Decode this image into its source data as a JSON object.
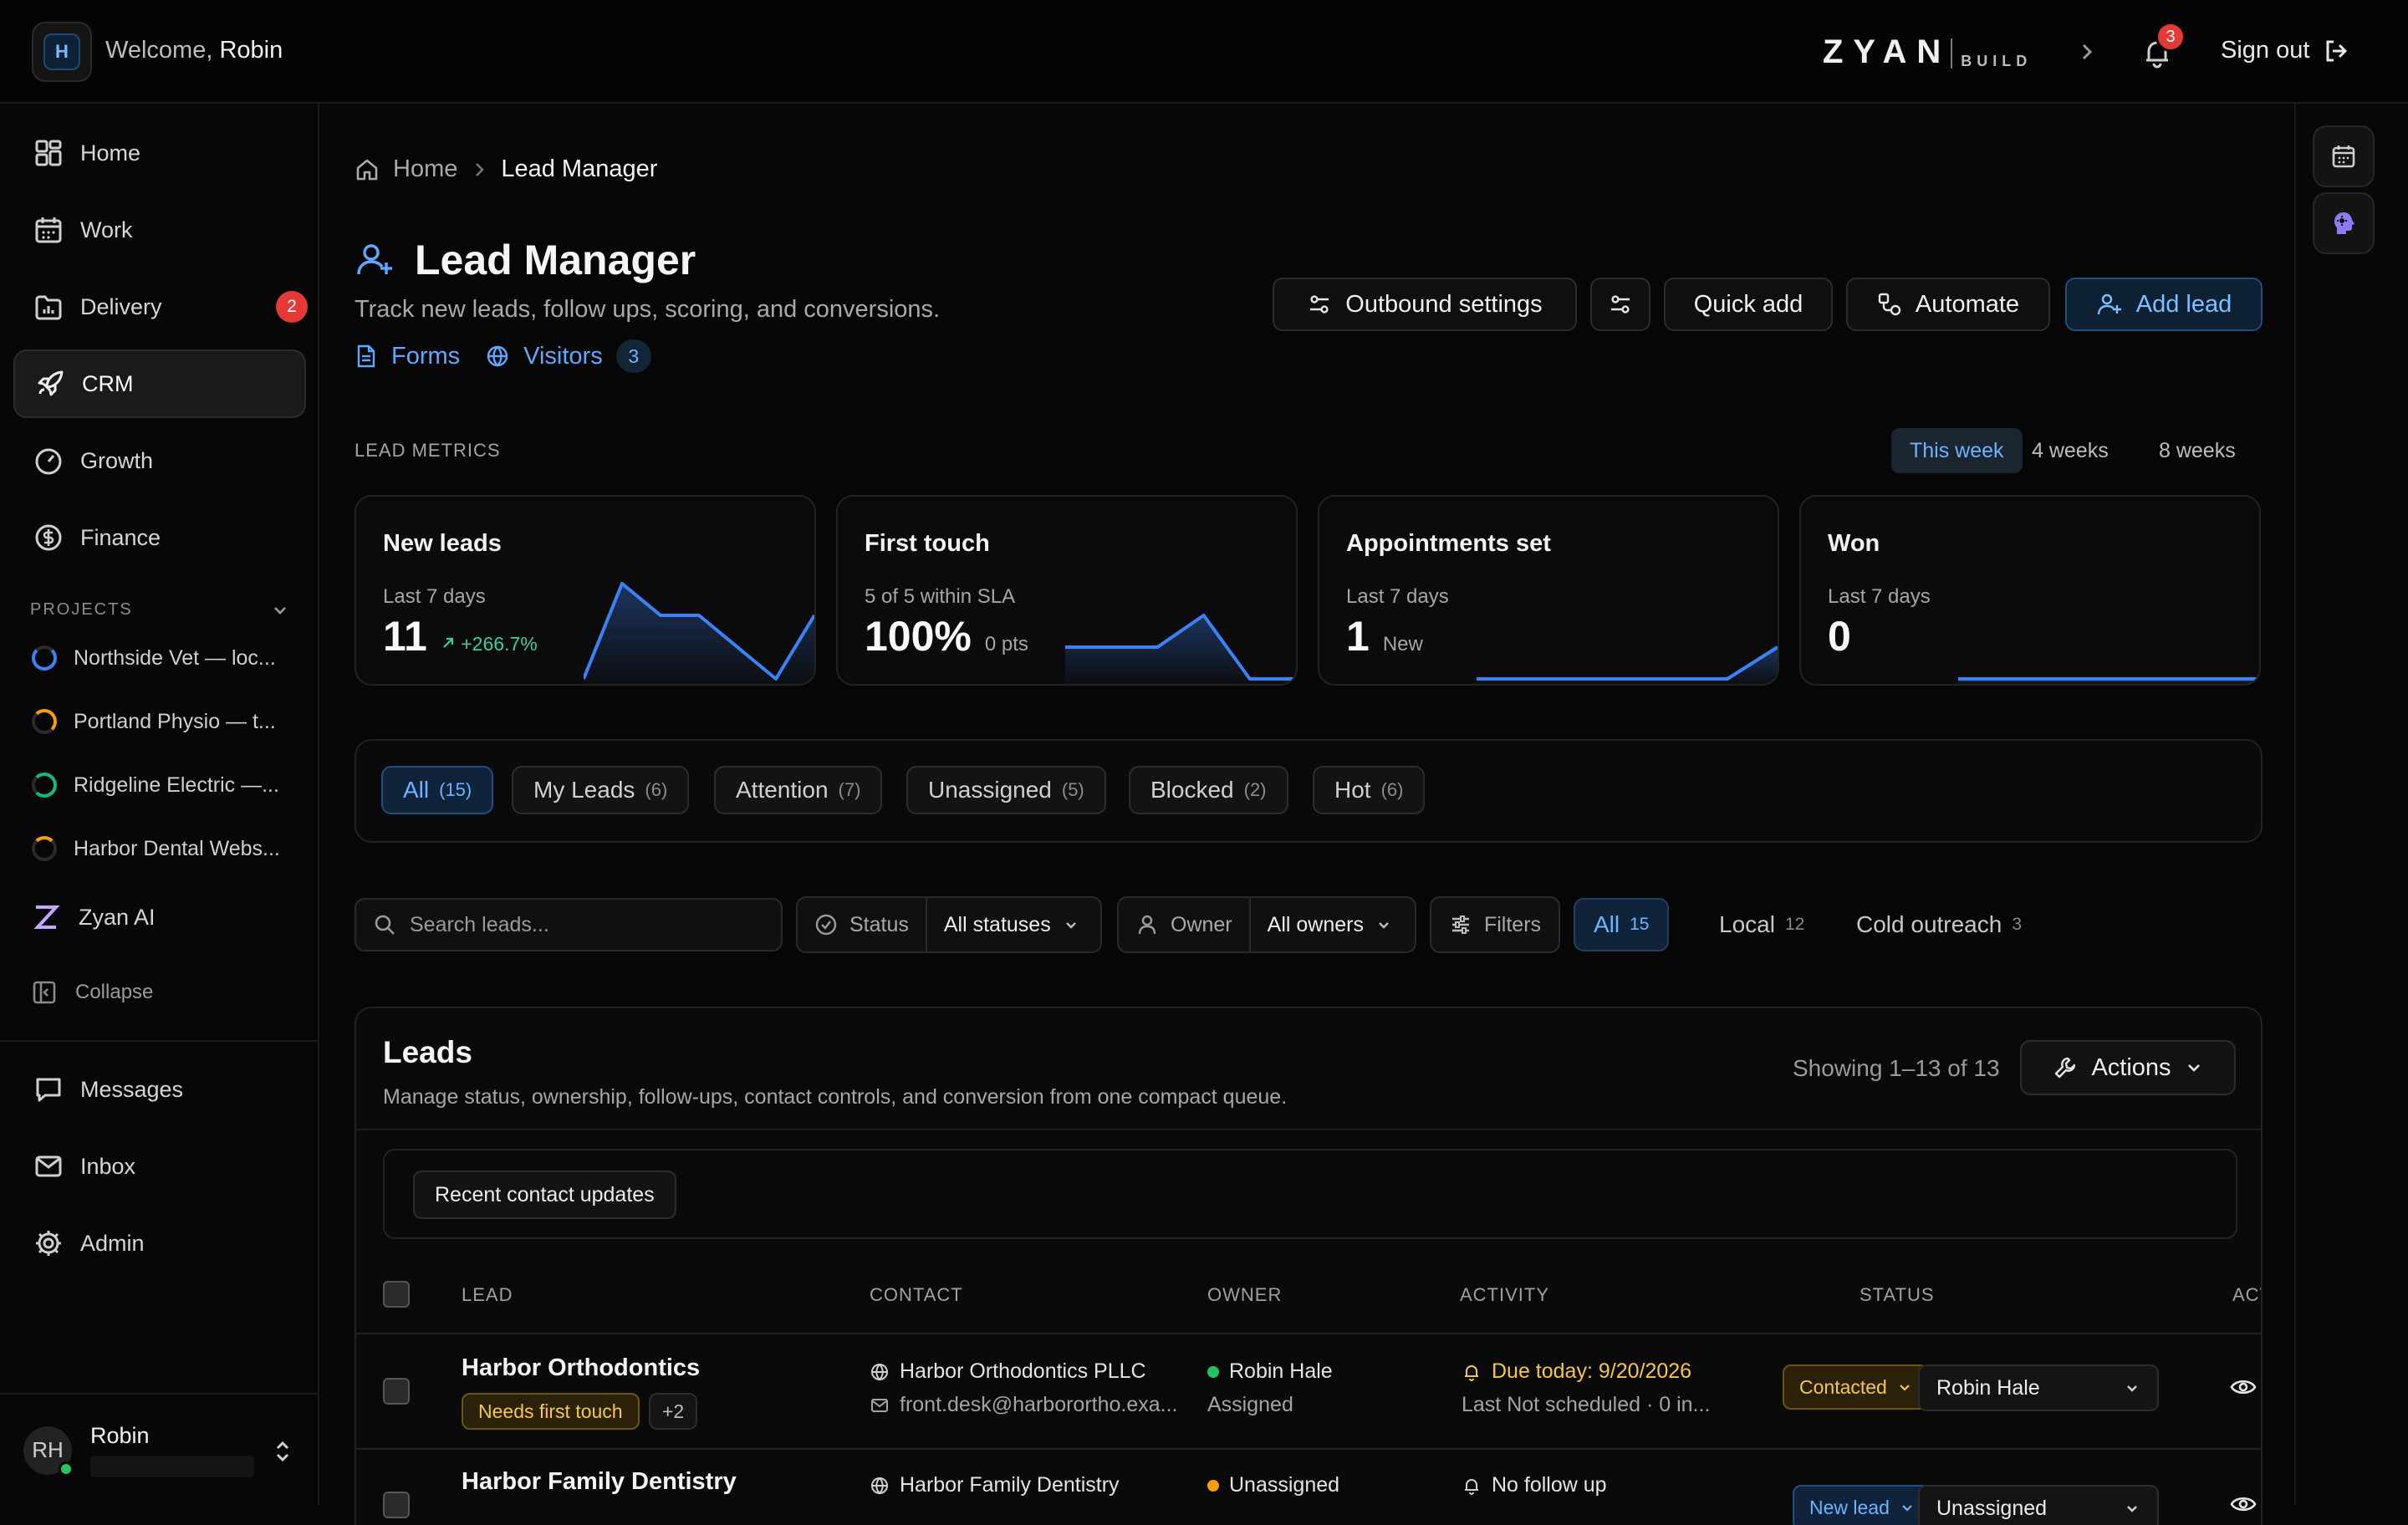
{
  "topbar": {
    "workspace_initial": "H",
    "welcome_prefix": "Welcome,",
    "welcome_name": "Robin",
    "brand": "ZYAN",
    "brand_sub": "BUILD",
    "notifications_count": "3",
    "sign_out": "Sign out"
  },
  "sidebar": {
    "items": [
      {
        "label": "Home",
        "icon": "dashboard-icon"
      },
      {
        "label": "Work",
        "icon": "calendar-icon"
      },
      {
        "label": "Delivery",
        "icon": "folder-chart-icon",
        "badge": "2"
      },
      {
        "label": "CRM",
        "icon": "rocket-icon",
        "active": true
      },
      {
        "label": "Growth",
        "icon": "gauge-icon"
      },
      {
        "label": "Finance",
        "icon": "dollar-circle-icon"
      }
    ],
    "projects_heading": "PROJECTS",
    "projects": [
      {
        "label": "Northside Vet — loc...",
        "color": "#3b82f6"
      },
      {
        "label": "Portland Physio — t...",
        "color": "#f59e0b"
      },
      {
        "label": "Ridgeline Electric —...",
        "color": "#10b981"
      },
      {
        "label": "Harbor Dental Webs...",
        "color": "#f59e0b"
      }
    ],
    "zyan_ai": "Zyan AI",
    "collapse": "Collapse",
    "bottom_items": [
      {
        "label": "Messages",
        "icon": "message-icon"
      },
      {
        "label": "Inbox",
        "icon": "mail-icon"
      },
      {
        "label": "Admin",
        "icon": "gear-icon"
      }
    ],
    "user": {
      "initials": "RH",
      "name": "Robin"
    }
  },
  "breadcrumb": {
    "home": "Home",
    "current": "Lead Manager"
  },
  "page": {
    "title": "Lead Manager",
    "subtitle": "Track new leads, follow ups, scoring, and conversions.",
    "forms_link": "Forms",
    "visitors_link": "Visitors",
    "visitors_count": "3"
  },
  "header_actions": {
    "outbound": "Outbound settings",
    "quick_add": "Quick add",
    "automate": "Automate",
    "add_lead": "Add lead"
  },
  "metrics": {
    "heading": "LEAD METRICS",
    "ranges": [
      "This week",
      "4 weeks",
      "8 weeks"
    ],
    "active_range": "This week",
    "cards": [
      {
        "title": "New leads",
        "sub": "Last 7 days",
        "value": "11",
        "delta": "+266.7%",
        "note": ""
      },
      {
        "title": "First touch",
        "sub": "5 of 5 within SLA",
        "value": "100%",
        "delta": "",
        "note": "0 pts"
      },
      {
        "title": "Appointments set",
        "sub": "Last 7 days",
        "value": "1",
        "delta": "",
        "note": "New"
      },
      {
        "title": "Won",
        "sub": "Last 7 days",
        "value": "0",
        "delta": "",
        "note": ""
      }
    ]
  },
  "chart_data": [
    {
      "type": "area",
      "title": "New leads",
      "values": [
        0,
        3,
        2,
        2,
        1,
        0,
        2
      ]
    },
    {
      "type": "area",
      "title": "First touch",
      "values": [
        1,
        1,
        1,
        2,
        0,
        0
      ]
    },
    {
      "type": "area",
      "title": "Appointments set",
      "values": [
        0,
        0,
        0,
        0,
        0,
        0,
        1
      ]
    },
    {
      "type": "area",
      "title": "Won",
      "values": [
        0,
        0,
        0,
        0,
        0,
        0,
        0
      ]
    }
  ],
  "segments": [
    {
      "label": "All",
      "count": "(15)",
      "active": true
    },
    {
      "label": "My Leads",
      "count": "(6)"
    },
    {
      "label": "Attention",
      "count": "(7)"
    },
    {
      "label": "Unassigned",
      "count": "(5)"
    },
    {
      "label": "Blocked",
      "count": "(2)"
    },
    {
      "label": "Hot",
      "count": "(6)"
    }
  ],
  "filters": {
    "search_placeholder": "Search leads...",
    "status_label": "Status",
    "status_value": "All statuses",
    "owner_label": "Owner",
    "owner_value": "All owners",
    "filters_label": "Filters",
    "types": [
      {
        "label": "All",
        "count": "15",
        "active": true
      },
      {
        "label": "Local",
        "count": "12"
      },
      {
        "label": "Cold outreach",
        "count": "3"
      }
    ]
  },
  "leads": {
    "title": "Leads",
    "subtitle": "Manage status, ownership, follow-ups, contact controls, and conversion from one compact queue.",
    "showing": "Showing 1–13 of 13",
    "actions": "Actions",
    "recent_updates": "Recent contact updates",
    "columns": [
      "LEAD",
      "CONTACT",
      "OWNER",
      "ACTIVITY",
      "STATUS",
      "ACTIONS"
    ],
    "rows": [
      {
        "name": "Harbor Orthodontics",
        "tag": "Needs first touch",
        "more": "+2",
        "company": "Harbor Orthodontics PLLC",
        "email": "front.desk@harborortho.exa...",
        "owner": "Robin Hale",
        "owner_status": "Assigned",
        "owner_color": "#22c55e",
        "activity": "Due today: 9/20/2026",
        "activity_sub": "Last Not scheduled · 0 in...",
        "status": "Contacted",
        "assignee": "Robin Hale"
      },
      {
        "name": "Harbor Family Dentistry",
        "tag": "",
        "more": "",
        "company": "Harbor Family Dentistry",
        "email": "",
        "owner": "Unassigned",
        "owner_status": "",
        "owner_color": "#f59e0b",
        "activity": "No follow up",
        "activity_sub": "",
        "status": "New lead",
        "assignee": "Unassigned"
      }
    ]
  }
}
